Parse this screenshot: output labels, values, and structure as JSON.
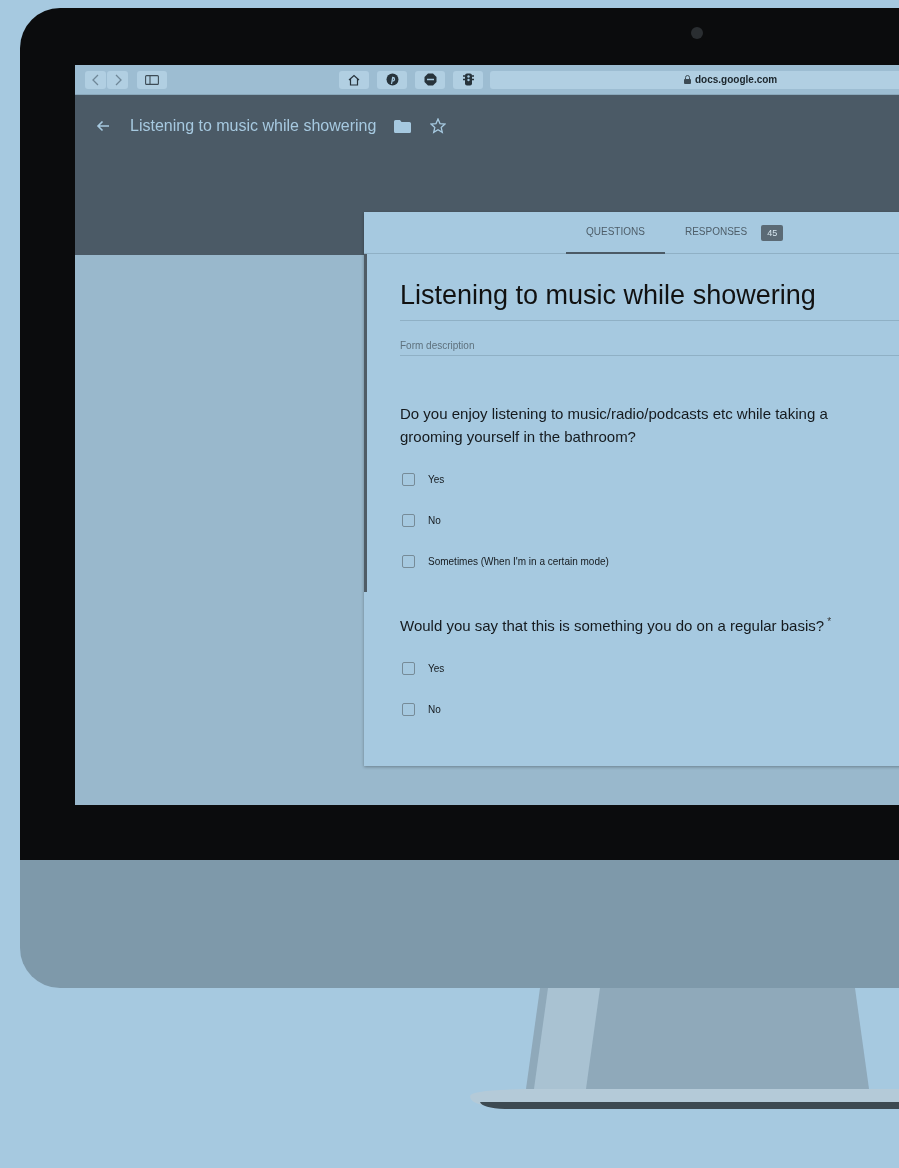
{
  "browser": {
    "address": "docs.google.com"
  },
  "header": {
    "title": "Listening to music while showering"
  },
  "tabs": [
    {
      "label": "QUESTIONS",
      "selected": true
    },
    {
      "label": "RESPONSES",
      "selected": false,
      "badge": "45"
    }
  ],
  "form": {
    "title": "Listening to music while showering",
    "description_placeholder": "Form description",
    "focused": true
  },
  "questions": [
    {
      "title": "Do you enjoy listening to music/radio/podcasts etc while taking a\ngrooming yourself in the bathroom?",
      "focused": true,
      "options": [
        {
          "label": "Yes",
          "checked": false
        },
        {
          "label": "No",
          "checked": false
        },
        {
          "label": "Sometimes (When I'm in a certain mode)",
          "checked": false
        }
      ]
    },
    {
      "title": "Would you say that this is something you do on a regular basis?",
      "required_mark": "*",
      "focused": false,
      "options": [
        {
          "label": "Yes",
          "checked": false
        },
        {
          "label": "No",
          "checked": false
        }
      ]
    }
  ]
}
